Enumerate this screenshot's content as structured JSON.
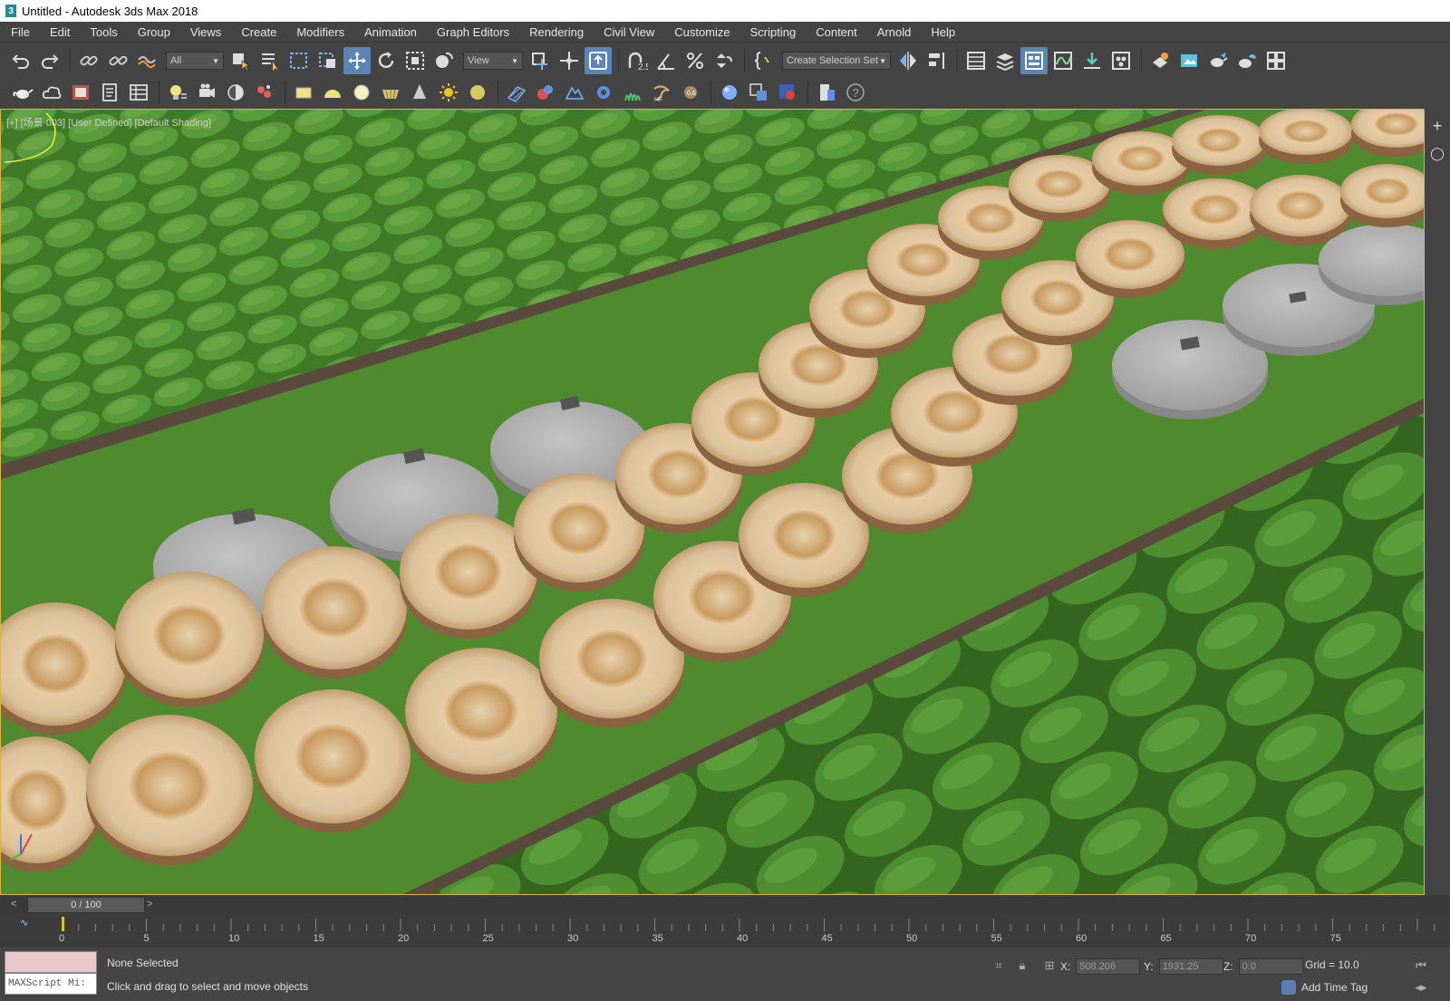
{
  "window": {
    "title": "Untitled - Autodesk 3ds Max 2018",
    "app_icon": "3"
  },
  "menu": [
    "File",
    "Edit",
    "Tools",
    "Group",
    "Views",
    "Create",
    "Modifiers",
    "Animation",
    "Graph Editors",
    "Rendering",
    "Civil View",
    "Customize",
    "Scripting",
    "Content",
    "Arnold",
    "Help"
  ],
  "toolbar": {
    "selection_filter": "All",
    "ref_coord": "View",
    "named_selection": "Create Selection Set",
    "snap_label": "2.5"
  },
  "viewport": {
    "label": "[+] [场景 003] [User Defined] [Default Shading]"
  },
  "timeline": {
    "frame_display": "0 / 100",
    "prev_arrow": "<",
    "next_arrow": ">",
    "tick_labels": [
      "0",
      "5",
      "10",
      "15",
      "20",
      "25",
      "30",
      "35",
      "40",
      "45",
      "50",
      "55",
      "60",
      "65",
      "70",
      "75"
    ]
  },
  "status": {
    "listener_text": "MAXScript Mi:",
    "selection": "None Selected",
    "prompt": "Click and drag to select and move objects",
    "x_label": "X:",
    "x_value": "508.206",
    "y_label": "Y:",
    "y_value": "1931.25",
    "z_label": "Z:",
    "z_value": "0.0",
    "grid": "Grid = 10.0",
    "add_time_tag": "Add Time Tag"
  },
  "colors": {
    "grass": "#4f8a2e",
    "bush": "#3f7a27",
    "path": "#5a4a3e",
    "wood": "#d9b98f",
    "stone": "#a9a9a9",
    "active_tool": "#5b84b8"
  }
}
